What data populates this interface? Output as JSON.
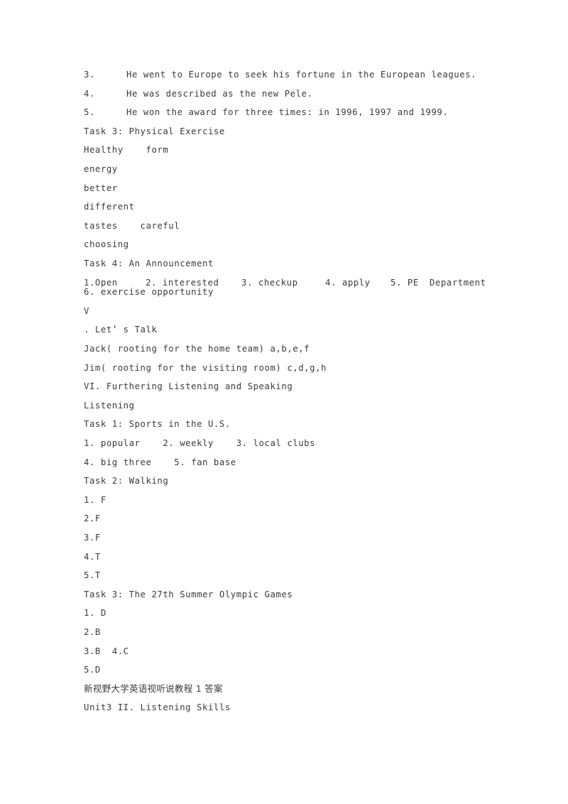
{
  "document": {
    "page_background": "#ffffff",
    "text_color": "#3b3b3b",
    "lines": {
      "q3_num": "3.",
      "q3_text": "He went to Europe to seek his fortune in the European leagues.",
      "q4_num": "4.",
      "q4_text": "He was described as the new Pele.",
      "q5_num": "5.",
      "q5_text": "He won the award for three times: in 1996, 1997 and 1999.",
      "task3_heading": "Task 3: Physical Exercise",
      "task3_a1": "Healthy    form",
      "task3_a2": "energy",
      "task3_a3": "better",
      "task3_a4": "different",
      "task3_a5": "tastes    careful",
      "task3_a6": "choosing",
      "task4_heading": "Task 4: An Announcement",
      "task4_c1": "1.Open",
      "task4_c2": "2. interested",
      "task4_c3": "3. checkup",
      "task4_c4": "4. apply",
      "task4_c5": "5. PE",
      "task4_c6": "Department",
      "task4_line2": "6. exercise opportunity",
      "section_v_numeral": "V",
      "section_v_title": ". Let’ s Talk",
      "jack_line": "Jack( rooting for the home team) a,b,e,f",
      "jim_line": "Jim( rooting for the visiting room) c,d,g,h",
      "section_vi_heading": "VI. Furthering Listening and Speaking",
      "listening_label": "Listening",
      "f_task1_heading": "Task 1: Sports in the U.S.",
      "f_task1_row1": "1. popular    2. weekly    3. local clubs",
      "f_task1_row2": "4. big three    5. fan base",
      "f_task2_heading": "Task 2: Walking",
      "f_task2_a1": "1. F",
      "f_task2_a2": "2.F",
      "f_task2_a3": "3.F",
      "f_task2_a4": "4.T",
      "f_task2_a5": "5.T",
      "f_task3_heading": "Task 3: The 27th Summer Olympic Games",
      "f_task3_a1": "1. D",
      "f_task3_a2": "2.B",
      "f_task3_a3": "3.B  4.C",
      "f_task3_a4": "5.D",
      "book_title_cjk": "新视野大学英语视听说教程 1 答案",
      "unit_heading": "Unit3 II. Listening Skills"
    }
  }
}
